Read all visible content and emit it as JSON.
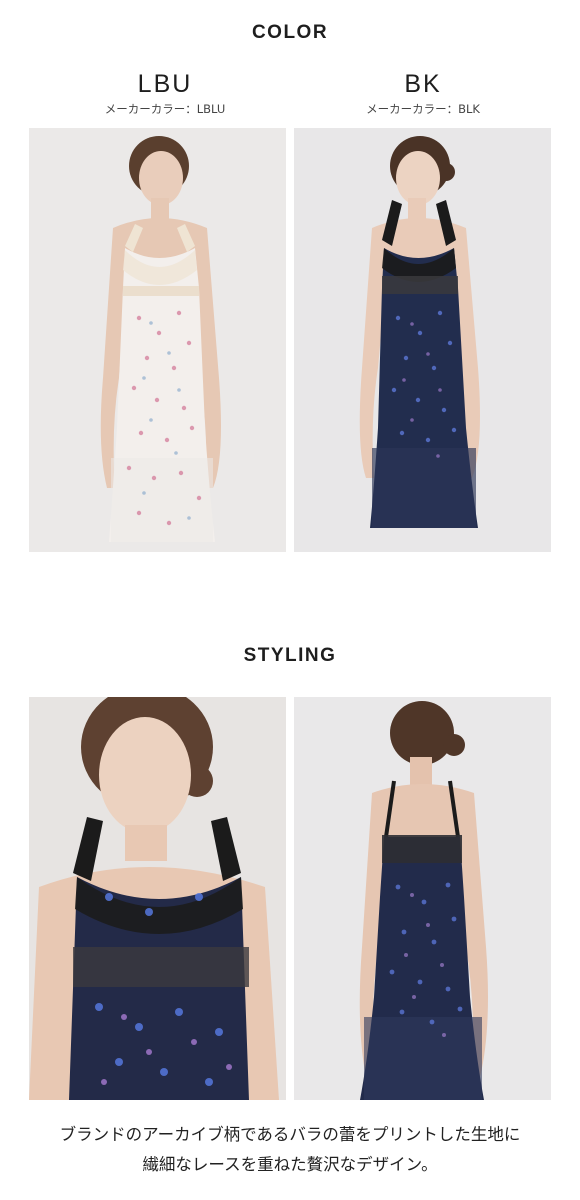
{
  "color_section": {
    "title": "COLOR",
    "variants": [
      {
        "code": "LBU",
        "maker_color": "メーカーカラー：LBLU"
      },
      {
        "code": "BK",
        "maker_color": "メーカーカラー：BLK"
      }
    ]
  },
  "styling_section": {
    "title": "STYLING"
  },
  "caption": {
    "line1": "ブランドのアーカイブ柄であるバラの蕾をプリントした生地に",
    "line2": "繊細なレースを重ねた贅沢なデザイン。"
  },
  "colors": {
    "background": "#ffffff",
    "photo_bg": "#e8e6e5",
    "dress_light": "#f1eeec",
    "dress_dark": "#1f2a4a",
    "lace": "#1a1a1a"
  }
}
